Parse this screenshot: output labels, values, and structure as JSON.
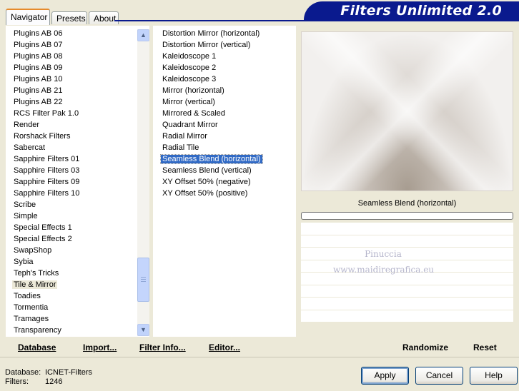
{
  "tabs": [
    "Navigator",
    "Presets",
    "About"
  ],
  "banner_title": "Filters Unlimited 2.0",
  "categories": [
    "Plugins AB 06",
    "Plugins AB 07",
    "Plugins AB 08",
    "Plugins AB 09",
    "Plugins AB 10",
    "Plugins AB 21",
    "Plugins AB 22",
    "RCS Filter Pak 1.0",
    "Render",
    "Rorshack Filters",
    "Sabercat",
    "Sapphire Filters 01",
    "Sapphire Filters 03",
    "Sapphire Filters 09",
    "Sapphire Filters 10",
    "Scribe",
    "Simple",
    "Special Effects 1",
    "Special Effects 2",
    "SwapShop",
    "Sybia",
    "Teph's Tricks",
    "Tile & Mirror",
    "Toadies",
    "Tormentia",
    "Tramages",
    "Transparency"
  ],
  "selected_category": "Tile & Mirror",
  "filters": [
    "Distortion Mirror (horizontal)",
    "Distortion Mirror (vertical)",
    "Kaleidoscope 1",
    "Kaleidoscope 2",
    "Kaleidoscope 3",
    "Mirror (horizontal)",
    "Mirror (vertical)",
    "Mirrored & Scaled",
    "Quadrant Mirror",
    "Radial Mirror",
    "Radial Tile",
    "Seamless Blend (horizontal)",
    "Seamless Blend (vertical)",
    "XY Offset 50% (negative)",
    "XY Offset 50% (positive)"
  ],
  "selected_filter": "Seamless Blend (horizontal)",
  "preview_filter_name": "Seamless Blend (horizontal)",
  "watermark": {
    "line1": "Pinuccia",
    "line2": "www.maidiregrafica.eu"
  },
  "bottom_links": {
    "database": "Database",
    "import": "Import...",
    "filter_info": "Filter Info...",
    "editor": "Editor..."
  },
  "right_links": {
    "randomize": "Randomize",
    "reset": "Reset"
  },
  "info": {
    "database_label": "Database:",
    "database_value": "ICNET-Filters",
    "filters_label": "Filters:",
    "filters_value": "1246"
  },
  "buttons": {
    "apply": "Apply",
    "cancel": "Cancel",
    "help": "Help"
  },
  "scroll_icons": {
    "up": "▲",
    "down": "▼"
  },
  "colors": {
    "banner": "#0a1a8e",
    "selection": "#316ac5",
    "tab_accent": "#e68b2c"
  }
}
